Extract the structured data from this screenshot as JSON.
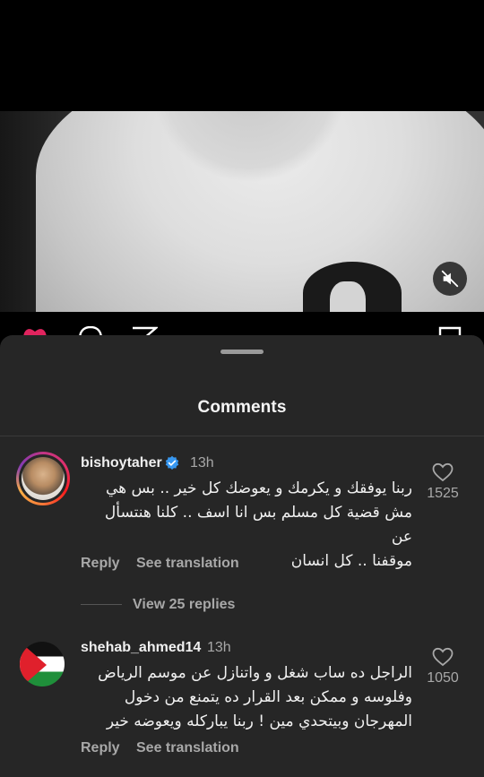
{
  "post": {
    "icons": {
      "mute": "speaker-muted-icon",
      "like": "heart-icon",
      "comment": "comment-icon",
      "share": "paper-plane-icon",
      "save": "bookmark-icon"
    },
    "like_color": "#e0245e"
  },
  "sheet": {
    "title": "Comments"
  },
  "comments": [
    {
      "username": "bishoytaher",
      "verified": true,
      "time": "13h",
      "lines": [
        "ربنا يوفقك و يكرمك و يعوضك كل خير .. بس هي",
        "مش قضية كل مسلم بس انا اسف .. كلنا هنتسأل عن",
        "موقفنا .. كل انسان"
      ],
      "reply_label": "Reply",
      "translation_label": "See translation",
      "likes": "1525",
      "view_replies": "View 25 replies",
      "avatar": "profile-photo"
    },
    {
      "username": "shehab_ahmed14",
      "verified": false,
      "time": "13h",
      "lines": [
        "الراجل ده ساب شغل و واتنازل عن موسم الرياض",
        "وفلوسه و ممكن بعد القرار ده يتمنع من دخول",
        "المهرجان وبيتحدي مين ! ربنا يباركله ويعوضه خير"
      ],
      "reply_label": "Reply",
      "translation_label": "See translation",
      "likes": "1050",
      "avatar": "palestine-flag"
    }
  ]
}
